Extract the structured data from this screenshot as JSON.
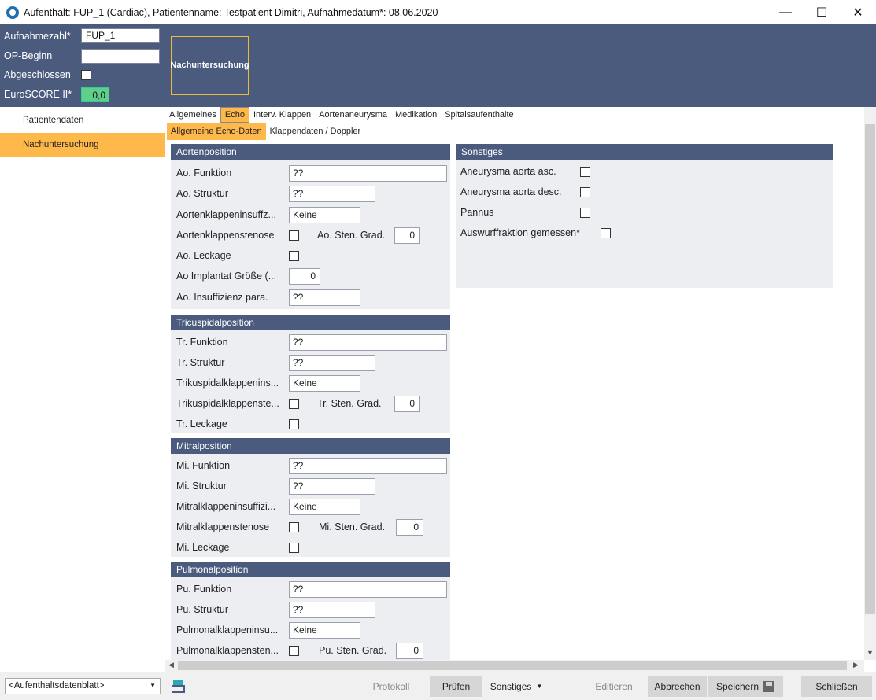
{
  "window": {
    "title": "Aufenthalt: FUP_1 (Cardiac), Patientenname: Testpatient Dimitri, Aufnahmedatum*: 08.06.2020",
    "minimize": "—",
    "maximize": "☐",
    "close": "✕"
  },
  "header": {
    "aufnahmezahl_label": "Aufnahmezahl*",
    "aufnahmezahl_value": "FUP_1",
    "op_beginn_label": "OP-Beginn",
    "op_beginn_value": "",
    "abgeschlossen_label": "Abgeschlossen",
    "euroscore_label": "EuroSCORE II*",
    "euroscore_value": "0,0",
    "tile_label": "Nachuntersuchung"
  },
  "sidebar": {
    "items": [
      {
        "label": "Patientendaten",
        "active": false
      },
      {
        "label": "Nachuntersuchung",
        "active": true
      }
    ]
  },
  "tabs": [
    "Allgemeines",
    "Echo",
    "Interv. Klappen",
    "Aortenaneurysma",
    "Medikation",
    "Spitalsaufenthalte"
  ],
  "subtabs": [
    "Allgemeine Echo-Daten",
    "Klappendaten / Doppler"
  ],
  "aorten": {
    "title": "Aortenposition",
    "funktion_label": "Ao. Funktion",
    "funktion_value": "??",
    "struktur_label": "Ao. Struktur",
    "struktur_value": "??",
    "insuff_label": "Aortenklappeninsuffz...",
    "insuff_value": "Keine",
    "stenose_label": "Aortenklappenstenose",
    "grad_label": "Ao. Sten. Grad.",
    "grad_value": "0",
    "leckage_label": "Ao. Leckage",
    "implantat_label": "Ao  Implantat  Größe (...",
    "implantat_value": "0",
    "insuff_para_label": "Ao. Insuffizienz para.",
    "insuff_para_value": "??"
  },
  "tricuspidal": {
    "title": "Tricuspidalposition",
    "funktion_label": "Tr. Funktion",
    "funktion_value": "??",
    "struktur_label": "Tr. Struktur",
    "struktur_value": "??",
    "insuff_label": "Trikuspidalklappenins...",
    "insuff_value": "Keine",
    "stenose_label": "Trikuspidalklappenste...",
    "grad_label": "Tr. Sten. Grad.",
    "grad_value": "0",
    "leckage_label": "Tr. Leckage"
  },
  "mitral": {
    "title": "Mitralposition",
    "funktion_label": "Mi. Funktion",
    "funktion_value": "??",
    "struktur_label": "Mi. Struktur",
    "struktur_value": "??",
    "insuff_label": "Mitralklappeninsuffizi...",
    "insuff_value": "Keine",
    "stenose_label": "Mitralklappenstenose",
    "grad_label": "Mi. Sten. Grad.",
    "grad_value": "0",
    "leckage_label": "Mi. Leckage"
  },
  "pulmonal": {
    "title": "Pulmonalposition",
    "funktion_label": "Pu. Funktion",
    "funktion_value": "??",
    "struktur_label": "Pu. Struktur",
    "struktur_value": "??",
    "insuff_label": "Pulmonalklappeninsu...",
    "insuff_value": "Keine",
    "stenose_label": "Pulmonalklappensten...",
    "grad_label": "Pu. Sten. Grad.",
    "grad_value": "0"
  },
  "sonstiges": {
    "title": "Sonstiges",
    "items": [
      "Aneurysma aorta asc.",
      "Aneurysma aorta desc.",
      "Pannus",
      "Auswurffraktion gemessen*"
    ]
  },
  "footer": {
    "combo_value": "<Aufenthaltsdatenblatt>",
    "protokoll": "Protokoll",
    "pruefen": "Prüfen",
    "sonstiges": "Sonstiges",
    "editieren": "Editieren",
    "abbrechen": "Abbrechen",
    "speichern": "Speichern",
    "schliessen": "Schließen"
  },
  "colors": {
    "header_bg": "#4b5b7d",
    "accent_orange": "#ffb84a",
    "euroscore_green": "#5fd08a"
  }
}
